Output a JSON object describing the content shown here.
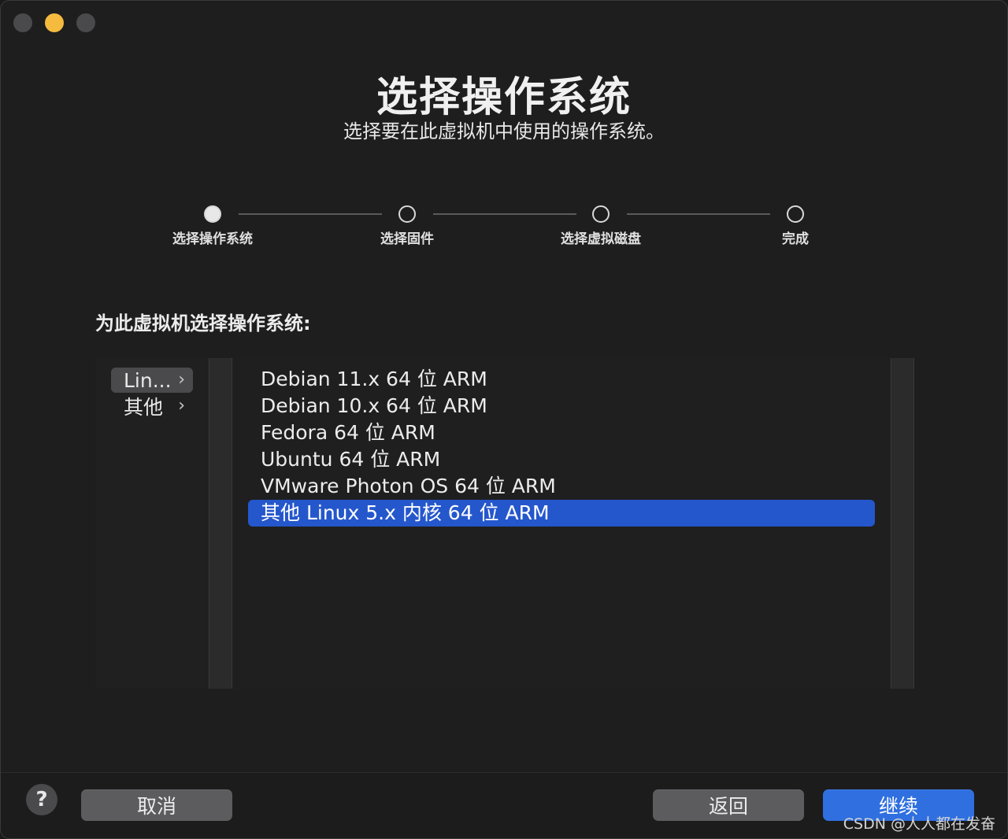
{
  "window": {
    "title": "选择操作系统",
    "subtitle": "选择要在此虚拟机中使用的操作系统。"
  },
  "steps": [
    {
      "label": "选择操作系统",
      "state": "active"
    },
    {
      "label": "选择固件",
      "state": "pending"
    },
    {
      "label": "选择虚拟磁盘",
      "state": "pending"
    },
    {
      "label": "完成",
      "state": "pending"
    }
  ],
  "prompt": "为此虚拟机选择操作系统:",
  "categories": [
    {
      "label": "Lin...",
      "selected": true
    },
    {
      "label": "其他",
      "selected": false
    }
  ],
  "os_list": [
    {
      "label": "Debian 11.x 64 位 ARM",
      "selected": false
    },
    {
      "label": "Debian 10.x 64 位 ARM",
      "selected": false
    },
    {
      "label": "Fedora 64 位 ARM",
      "selected": false
    },
    {
      "label": "Ubuntu 64 位 ARM",
      "selected": false
    },
    {
      "label": "VMware Photon OS 64 位 ARM",
      "selected": false
    },
    {
      "label": "其他 Linux 5.x 内核 64 位 ARM",
      "selected": true
    }
  ],
  "buttons": {
    "help": "?",
    "cancel": "取消",
    "back": "返回",
    "continue": "继续"
  },
  "watermark": "CSDN @人人都在发奋",
  "colors": {
    "accent": "#2557cc",
    "primary_button": "#2f6fe0",
    "minimize": "#f4bb3f"
  }
}
